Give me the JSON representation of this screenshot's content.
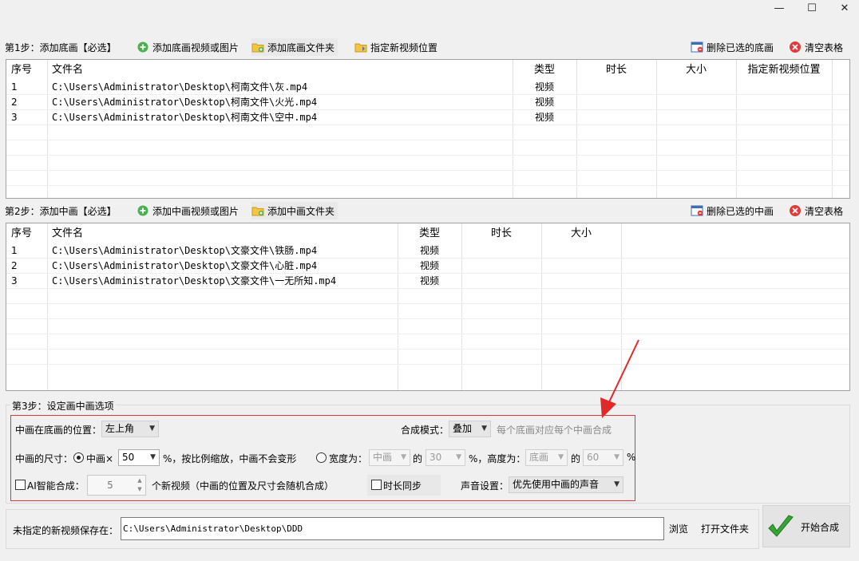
{
  "window": {
    "minimize": "—",
    "maximize": "☐",
    "close": "✕"
  },
  "step1": {
    "label": "第1步：添加底画【必选】",
    "buttons": {
      "add_media": "添加底画视频或图片",
      "add_folder": "添加底画文件夹",
      "set_location": "指定新视频位置",
      "delete_selected": "删除已选的底画",
      "clear": "清空表格"
    },
    "columns": [
      "序号",
      "文件名",
      "类型",
      "时长",
      "大小",
      "指定新视频位置"
    ],
    "rows": [
      [
        "1",
        "C:\\Users\\Administrator\\Desktop\\柯南文件\\灰.mp4",
        "视频"
      ],
      [
        "2",
        "C:\\Users\\Administrator\\Desktop\\柯南文件\\火光.mp4",
        "视频"
      ],
      [
        "3",
        "C:\\Users\\Administrator\\Desktop\\柯南文件\\空中.mp4",
        "视频"
      ]
    ]
  },
  "step2": {
    "label": "第2步：添加中画【必选】",
    "buttons": {
      "add_media": "添加中画视频或图片",
      "add_folder": "添加中画文件夹",
      "delete_selected": "删除已选的中画",
      "clear": "清空表格"
    },
    "columns": [
      "序号",
      "文件名",
      "类型",
      "时长",
      "大小"
    ],
    "rows": [
      [
        "1",
        "C:\\Users\\Administrator\\Desktop\\文豪文件\\铁肠.mp4",
        "视频"
      ],
      [
        "2",
        "C:\\Users\\Administrator\\Desktop\\文豪文件\\心脏.mp4",
        "视频"
      ],
      [
        "3",
        "C:\\Users\\Administrator\\Desktop\\文豪文件\\一无所知.mp4",
        "视频"
      ]
    ]
  },
  "step3": {
    "label": "第3步：设定画中画选项",
    "position_label": "中画在底画的位置：",
    "position_value": "左上角",
    "mode_label": "合成模式：",
    "mode_value": "叠加",
    "mode_hint": "每个底画对应每个中画合成",
    "size_label": "中画的尺寸：",
    "scale_radio": "中画×",
    "scale_value": "50",
    "scale_suffix": "%，按比例缩放，中画不会变形",
    "width_radio": "宽度为：",
    "width_ref": "中画",
    "of1": "的",
    "width_pct": "30",
    "height_label": "%，高度为：",
    "height_ref": "底画",
    "of2": "的",
    "height_pct": "60",
    "pct": "%",
    "ai_label": "AI智能合成：",
    "ai_count": "5",
    "ai_suffix": "个新视频（中画的位置及尺寸会随机合成）",
    "sync_label": "时长同步",
    "audio_label": "声音设置：",
    "audio_value": "优先使用中画的声音"
  },
  "output": {
    "label": "未指定的新视频保存在：",
    "path": "C:\\Users\\Administrator\\Desktop\\DDD",
    "browse": "浏览",
    "open_folder": "打开文件夹",
    "start": "开始合成"
  },
  "colors": {
    "annotation": "#e0292b",
    "check": "#2f9e2f"
  }
}
